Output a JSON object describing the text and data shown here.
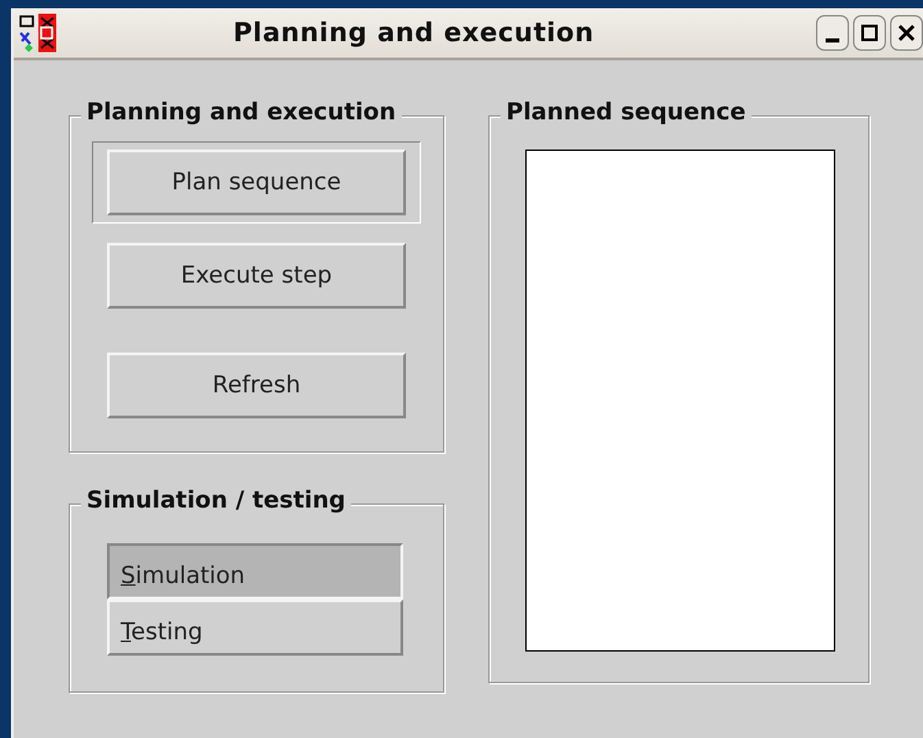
{
  "window": {
    "title": "Planning and execution"
  },
  "planning": {
    "title": "Planning and execution",
    "buttons": [
      {
        "label": "Plan sequence",
        "default": true
      },
      {
        "label": "Execute step",
        "default": false
      },
      {
        "label": "Refresh",
        "default": false
      }
    ]
  },
  "simulation": {
    "title": "Simulation / testing",
    "options": [
      {
        "label": "Simulation",
        "selected": true
      },
      {
        "label": "Testing",
        "selected": false
      }
    ]
  },
  "sequence": {
    "title": "Planned sequence"
  }
}
